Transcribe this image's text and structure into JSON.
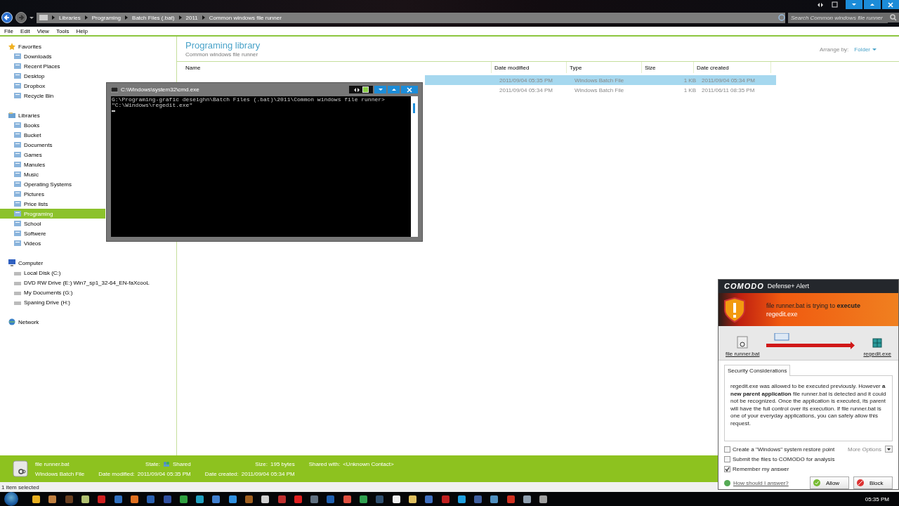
{
  "address_bar": {
    "crumbs": [
      "Libraries",
      "Programing",
      "Batch Files (.bat)",
      "2011",
      "Common windows file runner"
    ]
  },
  "search": {
    "placeholder": "Search Common windows file runner"
  },
  "menu": [
    "File",
    "Edit",
    "View",
    "Tools",
    "Help"
  ],
  "sidebar": {
    "groups": [
      {
        "label": "Favorites",
        "items": [
          {
            "label": "Downloads",
            "selected": false
          },
          {
            "label": "Recent Places",
            "selected": false
          },
          {
            "label": "Desktop",
            "selected": false
          },
          {
            "label": "Dropbox",
            "selected": false
          },
          {
            "label": "Recycle Bin",
            "selected": false
          }
        ]
      },
      {
        "label": "Libraries",
        "items": [
          {
            "label": "Books",
            "selected": false
          },
          {
            "label": "Bucket",
            "selected": false
          },
          {
            "label": "Documents",
            "selected": false
          },
          {
            "label": "Games",
            "selected": false
          },
          {
            "label": "Manules",
            "selected": false
          },
          {
            "label": "Music",
            "selected": false
          },
          {
            "label": "Operating Systems",
            "selected": false
          },
          {
            "label": "Pictures",
            "selected": false
          },
          {
            "label": "Price lists",
            "selected": false
          },
          {
            "label": "Programing",
            "selected": true
          },
          {
            "label": "School",
            "selected": false
          },
          {
            "label": "Softwere",
            "selected": false
          },
          {
            "label": "Videos",
            "selected": false
          }
        ]
      },
      {
        "label": "Computer",
        "items": [
          {
            "label": "Local Disk (C:)",
            "selected": false
          },
          {
            "label": "DVD RW Drive (E:) Win7_sp1_32-64_EN-faXcooL",
            "selected": false
          },
          {
            "label": "My Documents (G:)",
            "selected": false
          },
          {
            "label": "Spaning Drive (H:)",
            "selected": false
          }
        ]
      },
      {
        "label": "Network"
      }
    ]
  },
  "library": {
    "title": "Programing library",
    "subtitle": "Common windows file runner",
    "arrange_label": "Arrange by:",
    "arrange_value": "Folder"
  },
  "table": {
    "columns": [
      "Name",
      "Date modified",
      "Type",
      "Size",
      "Date created"
    ],
    "rows": [
      {
        "date_modified": "2011/09/04 05:35 PM",
        "type": "Windows Batch File",
        "size": "1 KB",
        "date_created": "2011/09/04 05:34 PM",
        "selected": true
      },
      {
        "date_modified": "2011/09/04 05:34 PM",
        "type": "Windows Batch File",
        "size": "1 KB",
        "date_created": "2011/06/11 08:35 PM",
        "selected": false
      }
    ]
  },
  "cmd": {
    "title": "C:\\Windows\\system32\\cmd.exe",
    "lines": [
      "G:\\Programing-grafic deseighn\\Batch Files (.bat)\\2011\\Common windows file runner>",
      "\"C:\\Windows\\regedit.exe\""
    ]
  },
  "details": {
    "name": "file runner.bat",
    "type": "Windows Batch File",
    "fields": [
      {
        "label": "State:",
        "value": "Shared"
      },
      {
        "label": "Date modified:",
        "value": "2011/09/04 05:35 PM"
      },
      {
        "label": "Size:",
        "value": "195 bytes"
      },
      {
        "label": "Date created:",
        "value": "2011/09/04 05:34 PM"
      },
      {
        "label": "Shared with:",
        "value": "<Unknown Contact>"
      }
    ]
  },
  "status_bar": "1 item selected",
  "alert": {
    "brand": "COMODO",
    "title": "Defense+ Alert",
    "message": "file runner.bat is trying to **execute**",
    "target": "regedit.exe",
    "source_link": "file runner.bat",
    "target_link": "regedit.exe",
    "tab": "Security Considerations",
    "body": "regedit.exe was allowed to be executed previously. However **a new parent application** file runner.bat is detected and it could not be recognized. Once the application is executed, its parent will have the full control over its execution. If file runner.bat is one of your everyday applications, you can safely allow this request.",
    "options": [
      {
        "label": "Create a \"Windows\" system restore point",
        "checked": false
      },
      {
        "label": "Submit the files to COMODO for analysis",
        "checked": false
      },
      {
        "label": "Remember my answer",
        "checked": true
      }
    ],
    "more_options": "More Options",
    "help_link": "How should I answer?",
    "buttons": [
      {
        "label": "Allow",
        "kind": "allow"
      },
      {
        "label": "Block",
        "kind": "block"
      }
    ]
  },
  "taskbar": {
    "apps": [
      {
        "color": "#e8b020"
      },
      {
        "color": "#c08040"
      },
      {
        "color": "#6a4020"
      },
      {
        "color": "#b0c070"
      },
      {
        "color": "#d02020"
      },
      {
        "color": "#3070c0"
      },
      {
        "color": "#e07020"
      },
      {
        "color": "#2a60b0"
      },
      {
        "color": "#3050a0"
      },
      {
        "color": "#30a040"
      },
      {
        "color": "#20a0c0"
      },
      {
        "color": "#4080d0"
      },
      {
        "color": "#3090e0"
      },
      {
        "color": "#a06020"
      },
      {
        "color": "#d0d0d0"
      },
      {
        "color": "#c03030"
      },
      {
        "color": "#e02020"
      },
      {
        "color": "#607080"
      },
      {
        "color": "#2060b0"
      },
      {
        "color": "#e05040"
      },
      {
        "color": "#30a050"
      },
      {
        "color": "#305070"
      },
      {
        "color": "#f0f0f0"
      },
      {
        "color": "#e0c060"
      },
      {
        "color": "#4070c0"
      },
      {
        "color": "#c02020"
      },
      {
        "color": "#20a0e0"
      },
      {
        "color": "#4060a0"
      },
      {
        "color": "#5090c0"
      },
      {
        "color": "#d03020"
      },
      {
        "color": "#90a0b0"
      },
      {
        "color": "#a0a0a0"
      }
    ],
    "clock": "05:35 PM"
  }
}
